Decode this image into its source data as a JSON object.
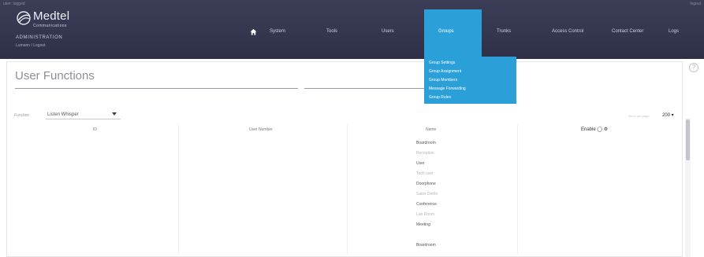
{
  "window": {
    "top_left_text": "user: logged",
    "top_right_text": "logout"
  },
  "brand": {
    "name": "Medtel",
    "tagline": "Communications",
    "section": "ADMINISTRATION",
    "user": "Lumann / Logout"
  },
  "nav": {
    "home_icon": "home-icon",
    "items": [
      "System",
      "Tools",
      "Users",
      "Groups",
      "Trunks",
      "Access Control",
      "Contact Center",
      "Logs"
    ],
    "active": "Groups"
  },
  "dropdown": {
    "items": [
      "Group Settings",
      "Group Assignment",
      "Group Members",
      "Message Forwarding",
      "Group Rules"
    ]
  },
  "page": {
    "title": "User Functions",
    "filter_label": "Function",
    "filter_value": "Listen Whisper",
    "page_size_label": "items per page",
    "page_size": "200 ▾"
  },
  "table": {
    "headers": {
      "id": "ID",
      "user_number": "User Number",
      "name": "Name",
      "actions": "Enable ◯ ⚙"
    },
    "rows": [
      {
        "id": "",
        "num": "",
        "name": "Boardroom",
        "style": "dark"
      },
      {
        "id": "",
        "num": "",
        "name": "Reception",
        "style": "light"
      },
      {
        "id": "",
        "num": "",
        "name": "User",
        "style": "dark"
      },
      {
        "id": "",
        "num": "",
        "name": "Tech user",
        "style": "light"
      },
      {
        "id": "",
        "num": "",
        "name": "Doorphone",
        "style": "dark"
      },
      {
        "id": "",
        "num": "",
        "name": "Sales Demo",
        "style": "light"
      },
      {
        "id": "",
        "num": "",
        "name": "Conference",
        "style": "dark"
      },
      {
        "id": "",
        "num": "",
        "name": "Lab Room",
        "style": "light"
      },
      {
        "id": "",
        "num": "",
        "name": "Meeting",
        "style": "dark"
      },
      {
        "id": "",
        "num": "",
        "name": "",
        "style": "light"
      },
      {
        "id": "",
        "num": "",
        "name": "Boardroom",
        "style": "dark"
      }
    ]
  }
}
